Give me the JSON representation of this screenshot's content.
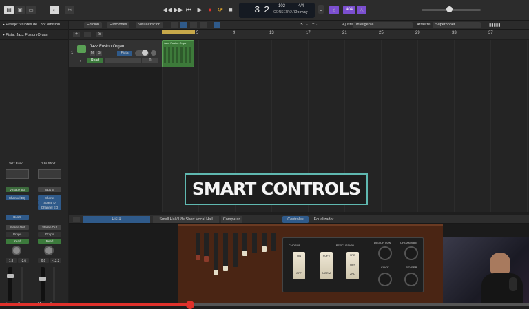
{
  "transport": {
    "position_bar": "3",
    "position_beat": "2",
    "tempo": "102",
    "tempo_label": "CONSERVAR",
    "signature": "4/4",
    "key": "Do may",
    "badge": "404"
  },
  "tracks_menu": {
    "edit": "Edición",
    "functions": "Funciones",
    "view": "Visualización",
    "snap_label": "Ajuste:",
    "snap_value": "Inteligente",
    "drag_label": "Arrastre:",
    "drag_value": "Superponer"
  },
  "inspector": {
    "region_label": "Pasaje: Valores de...por omisión",
    "track_label": "Pista: Jazz Fusion Organ",
    "strip1": {
      "name": "Jazz Fusio...",
      "slot1": "Vintage B3",
      "slot2": "Channel EQ",
      "send": "Bus 5",
      "output": "Stereo Out",
      "group": "Grupo",
      "auto": "Read",
      "pan": "1,8",
      "vol": "-2,6",
      "m": "M",
      "s": "S"
    },
    "strip2": {
      "name": "1.8s Short...",
      "slot1": "Bus 5",
      "slot2": "Chorus",
      "slot3": "Space D",
      "slot4": "Channel EQ",
      "output": "Stereo Out",
      "group": "Grupo",
      "auto": "Read",
      "pan": "0,0",
      "vol": "-12,2",
      "m": "M",
      "s": "S"
    }
  },
  "ruler": {
    "bars": [
      "5",
      "9",
      "13",
      "17",
      "21",
      "25",
      "29",
      "33",
      "37"
    ]
  },
  "track": {
    "number": "1",
    "name": "Jazz Fusion Organ",
    "mute": "M",
    "solo": "S",
    "region_name": "Jazz Fusion Organ",
    "pista_btn": "Pista",
    "auto": "Read",
    "vol_value": "0"
  },
  "overlay": {
    "title": "SMART CONTROLS"
  },
  "smart_controls": {
    "pista": "Pista",
    "preset": "Small Hall/1.8s Short Vocal Hall",
    "compare": "Comparar",
    "tab_controls": "Controles",
    "tab_eq": "Ecualizador"
  },
  "organ": {
    "chorus": "CHORUS",
    "percussion": "PERCUSSION",
    "distortion": "DISTORTION",
    "organ_vibe": "ORGAN VIBE",
    "click": "CLICK",
    "reverb": "REVERB",
    "on": "ON",
    "off": "OFF",
    "soft": "SOFT",
    "norm": "NORM",
    "third": "3RD",
    "off2": "OFF",
    "second": "2ND"
  },
  "video": {
    "progress": 0.36
  },
  "colors": {
    "accent_teal": "#5fb8b0",
    "region_green": "#3d7a3a",
    "record_red": "#e0312b"
  }
}
